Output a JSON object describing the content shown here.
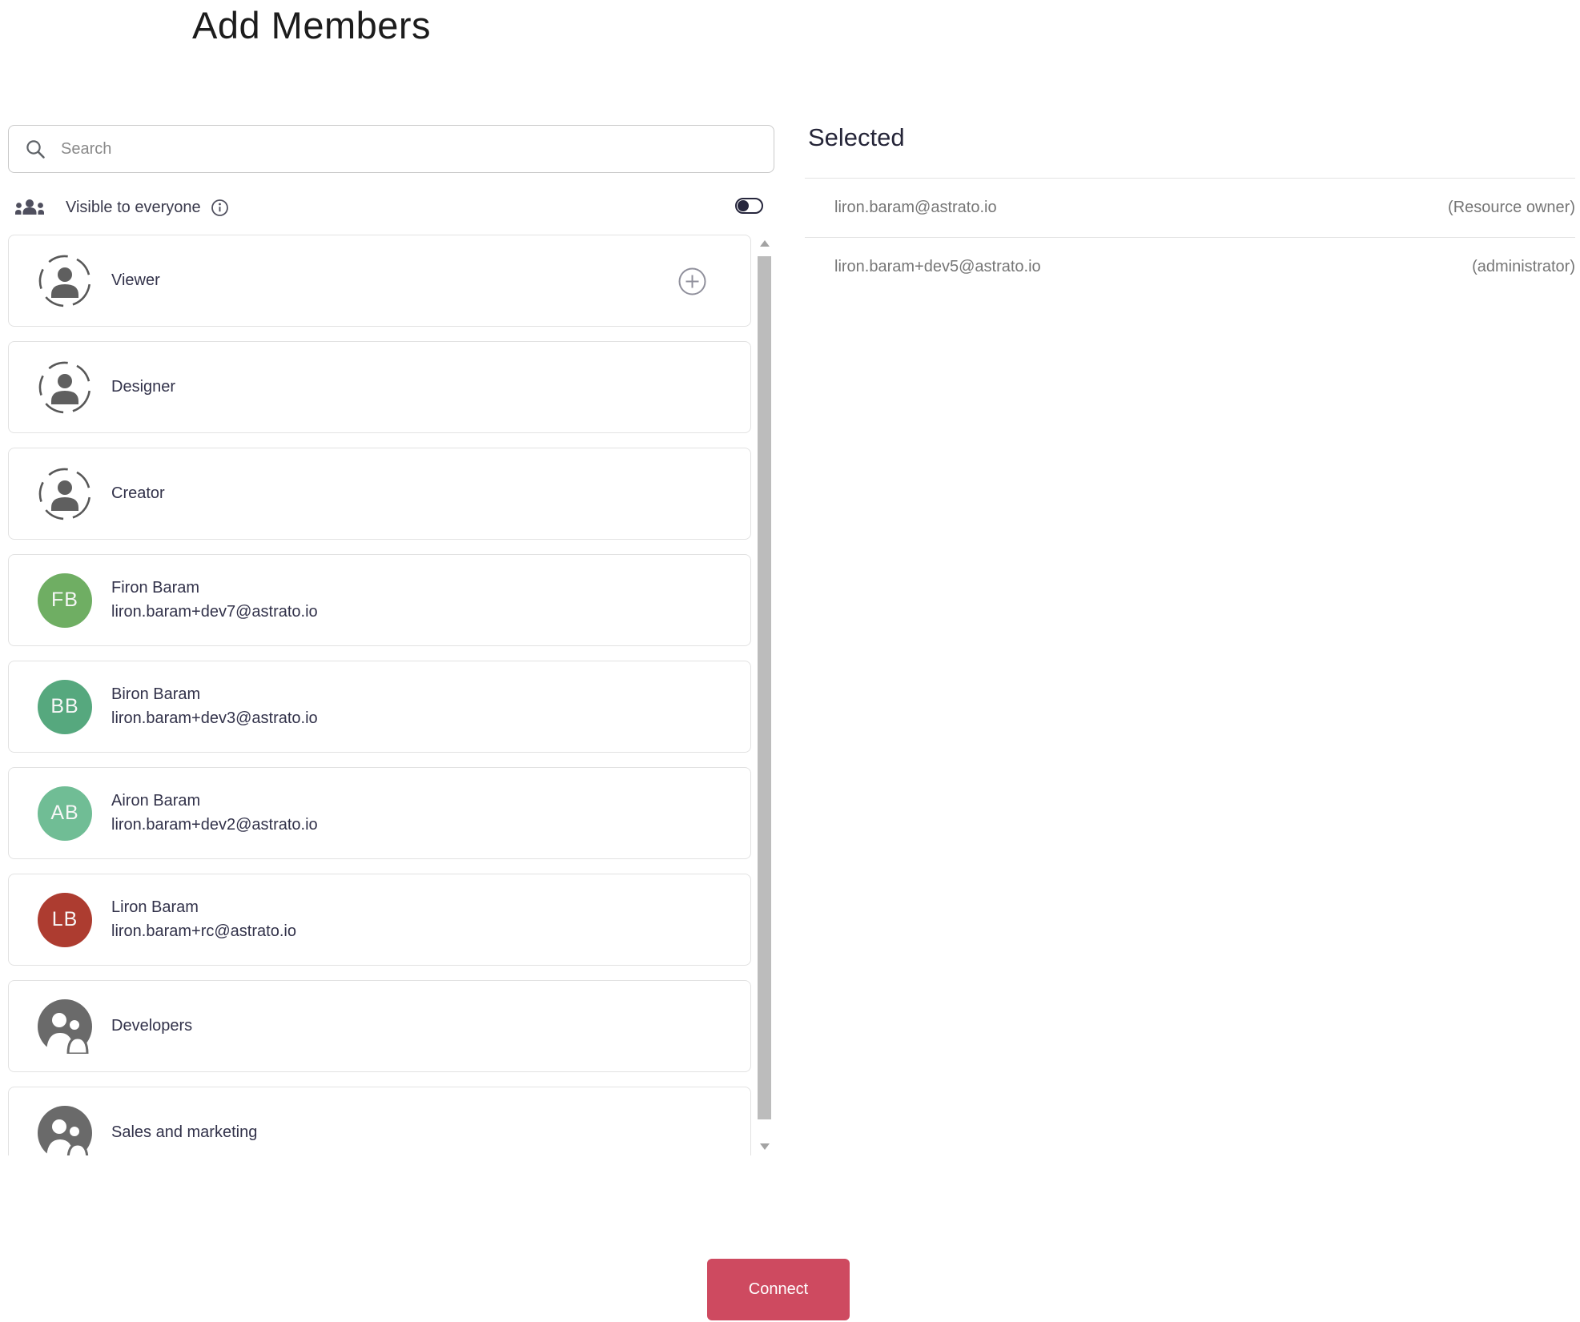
{
  "title": "Add Members",
  "search": {
    "placeholder": "Search"
  },
  "visibility": {
    "label": "Visible to everyone",
    "enabled": false
  },
  "roles": [
    {
      "label": "Viewer"
    },
    {
      "label": "Designer"
    },
    {
      "label": "Creator"
    }
  ],
  "users": [
    {
      "initials": "FB",
      "name": "Firon Baram",
      "email": "liron.baram+dev7@astrato.io",
      "color": "#6fae63"
    },
    {
      "initials": "BB",
      "name": "Biron Baram",
      "email": "liron.baram+dev3@astrato.io",
      "color": "#56a87e"
    },
    {
      "initials": "AB",
      "name": "Airon Baram",
      "email": "liron.baram+dev2@astrato.io",
      "color": "#70bd95"
    },
    {
      "initials": "LB",
      "name": "Liron Baram",
      "email": "liron.baram+rc@astrato.io",
      "color": "#ad3c30"
    }
  ],
  "groups": [
    {
      "label": "Developers"
    },
    {
      "label": "Sales and marketing"
    }
  ],
  "selected": {
    "heading": "Selected",
    "items": [
      {
        "email": "liron.baram@astrato.io",
        "role": "(Resource owner)"
      },
      {
        "email": "liron.baram+dev5@astrato.io",
        "role": "(administrator)"
      }
    ]
  },
  "actions": {
    "connect_label": "Connect"
  },
  "icons": {
    "search": "magnifier",
    "visibility": "groups-three-people",
    "info": "info-circle",
    "role": "person-in-dashed-circle",
    "group": "two-people-filled-circle",
    "add": "plus-circle"
  },
  "colors": {
    "accent": "#ce4a60",
    "toggle": "#26263c",
    "card_border": "#e2e2e2",
    "muted_text": "#767676"
  }
}
